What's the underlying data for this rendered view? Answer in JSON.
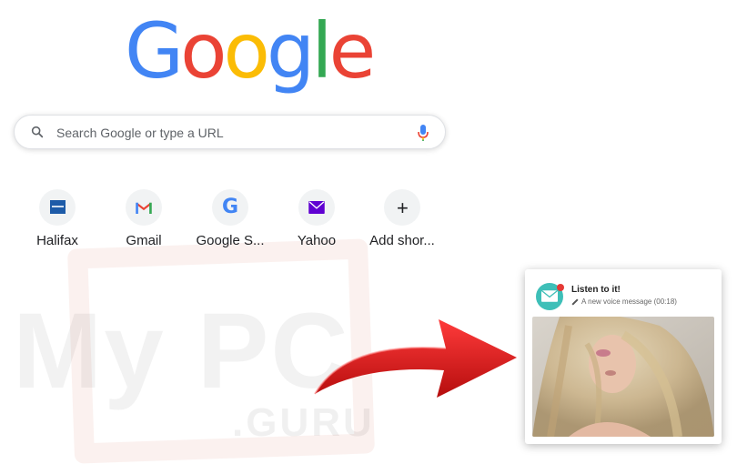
{
  "logo": {
    "letters": [
      "G",
      "o",
      "o",
      "g",
      "l",
      "e"
    ],
    "colors": [
      "#4285f4",
      "#ea4335",
      "#fbbc05",
      "#4285f4",
      "#34a853",
      "#ea4335"
    ]
  },
  "search": {
    "placeholder": "Search Google or type a URL",
    "search_icon": "search-icon",
    "mic_icon": "microphone-icon"
  },
  "shortcuts": [
    {
      "label": "Halifax",
      "icon": "halifax-icon"
    },
    {
      "label": "Gmail",
      "icon": "gmail-icon"
    },
    {
      "label": "Google S...",
      "icon": "google-icon"
    },
    {
      "label": "Yahoo",
      "icon": "yahoo-mail-icon"
    },
    {
      "label": "Add shor...",
      "icon": "plus-icon"
    }
  ],
  "notification": {
    "title": "Listen to it!",
    "subtitle": "A new voice message (00:18)",
    "icon": "envelope-icon",
    "sub_icon": "pencil-icon"
  },
  "watermark": {
    "main": "My PC",
    "sub": ".GURU"
  },
  "colors": {
    "accent_arrow": "#e0201f",
    "notification_avatar": "#3ebfb8"
  }
}
